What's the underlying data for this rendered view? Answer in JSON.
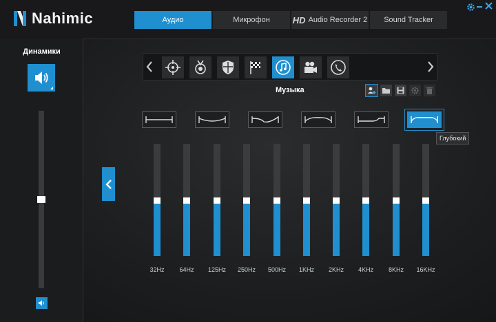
{
  "app": {
    "title": "Nahimic"
  },
  "tabs": [
    {
      "label": "Аудио",
      "active": true
    },
    {
      "label": "Микрофон",
      "active": false
    },
    {
      "hd": "HD",
      "label": "Audio Recorder 2",
      "active": false
    },
    {
      "label": "Sound Tracker",
      "active": false
    }
  ],
  "sidebar": {
    "title": "Динамики",
    "volume_level": 0.5
  },
  "presets": {
    "icons": [
      "crosshair-icon",
      "medal-icon",
      "shield-icon",
      "checkered-flag-icon",
      "music-note-icon",
      "video-camera-icon",
      "phone-icon"
    ],
    "active_index": 4,
    "name": "Музыка"
  },
  "eq_curves": {
    "names": [
      "flat",
      "bass-boost",
      "treble-boost",
      "mid",
      "mid-treble",
      "deep"
    ],
    "active_index": 5,
    "tooltip": "Глубокий"
  },
  "eq": {
    "bands": [
      "32Hz",
      "64Hz",
      "125Hz",
      "250Hz",
      "500Hz",
      "1KHz",
      "2KHz",
      "4KHz",
      "8KHz",
      "16KHz"
    ],
    "levels": [
      0.5,
      0.5,
      0.5,
      0.5,
      0.5,
      0.5,
      0.5,
      0.5,
      0.5,
      0.5
    ]
  },
  "colors": {
    "accent": "#1f8fd0",
    "background": "#1a1b1d",
    "track": "#3b3c3e"
  }
}
